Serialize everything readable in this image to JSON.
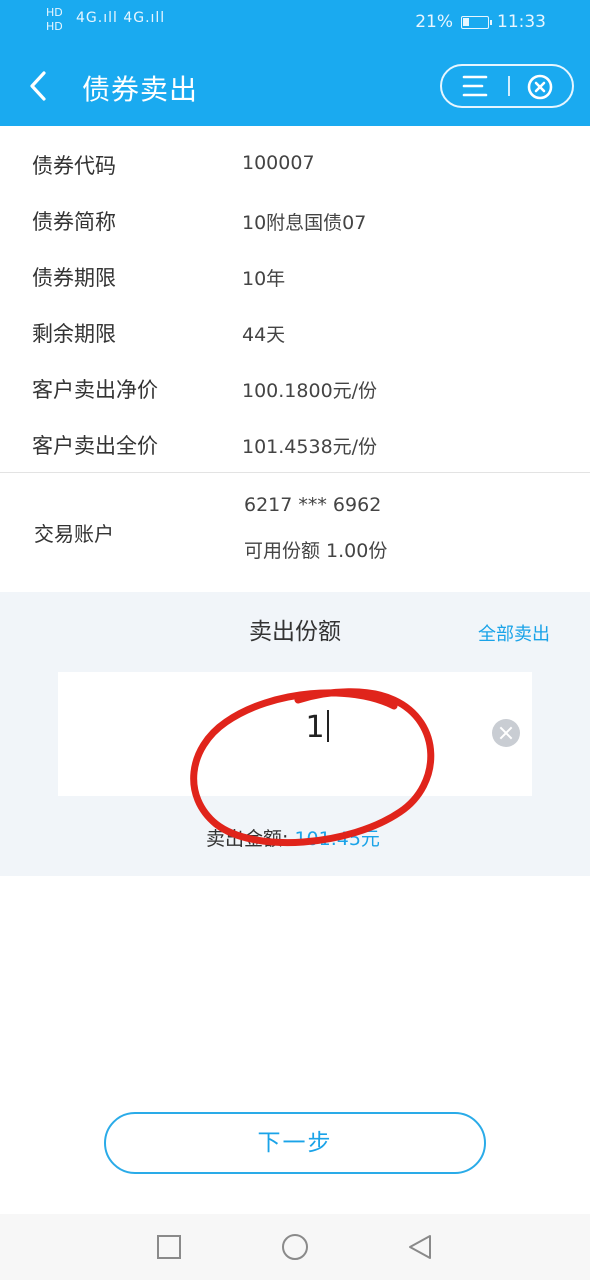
{
  "status_bar": {
    "hd_top": "HD",
    "hd_bottom": "HD",
    "signal": "4G.ıll 4G.ıll",
    "battery": "21%",
    "time": "11:33"
  },
  "nav": {
    "title": "债券卖出"
  },
  "bond": {
    "rows": [
      {
        "label": "债券代码",
        "value": "100007"
      },
      {
        "label": "债券简称",
        "value": "10附息国债07"
      },
      {
        "label": "债券期限",
        "value": "10年"
      },
      {
        "label": "剩余期限",
        "value": "44天"
      },
      {
        "label": "客户卖出净价",
        "value": "100.1800元/份"
      },
      {
        "label": "客户卖出全价",
        "value": "101.4538元/份"
      }
    ]
  },
  "account": {
    "label": "交易账户",
    "number": "6217 *** 6962",
    "available": "可用份额   1.00份"
  },
  "sell": {
    "title": "卖出份额",
    "sell_all": "全部卖出",
    "input_value": "1",
    "amount_label": "卖出金额:",
    "amount_value": "101.45元"
  },
  "next_button": "下一步",
  "colors": {
    "primary": "#1aaaf0",
    "accent_text": "#1aa3e8",
    "annotation": "#e0241b"
  }
}
